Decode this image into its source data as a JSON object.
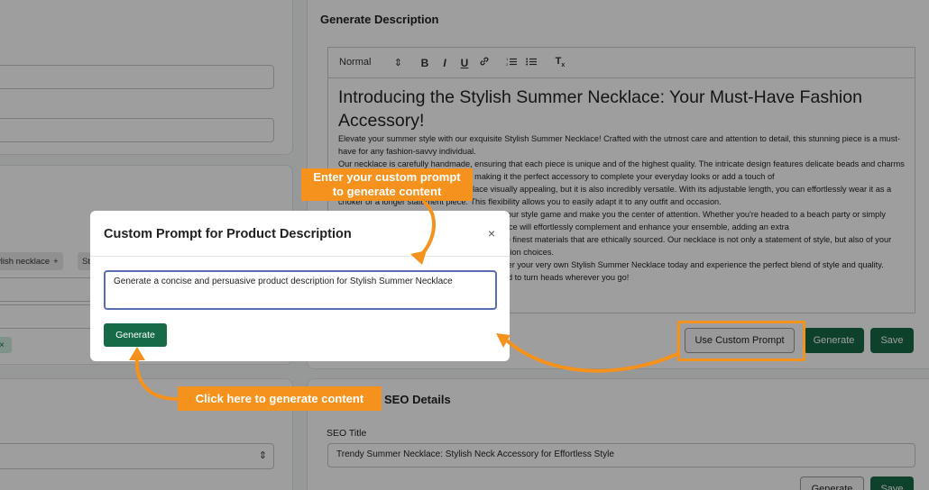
{
  "left_panel": {
    "tags": [
      {
        "label": "ylish necklace",
        "remove": "+"
      },
      {
        "label": "St",
        "remove": ""
      }
    ],
    "chip_green_label": "×"
  },
  "description_section": {
    "title": "Generate Description",
    "toolbar": {
      "format_select": "Normal",
      "select_arrow": "⇕",
      "bold": "B",
      "italic": "I",
      "underline": "U",
      "link": "🔗",
      "ordered_list": "1≡",
      "bullet_list": "•≡",
      "clear_format": "Tx"
    },
    "heading": "Introducing the Stylish Summer Necklace: Your Must-Have Fashion Accessory!",
    "paragraphs": [
      "Elevate your summer style with our exquisite Stylish Summer Necklace! Crafted with the utmost care and attention to detail, this stunning piece is a must-have for any fashion-savvy individual.",
      "Our necklace is carefully handmade, ensuring that each piece is unique and of the highest quality. The intricate design features delicate beads and charms that capture the essence of summer, making it the perfect accessory to complete your everyday looks or add a touch of",
      "Not only is our Stylish Summer Necklace visually appealing, but it is also incredibly versatile. With its adjustable length, you can effortlessly wear it as a choker or a longer statement piece. This flexibility allows you to easily adapt it to any outfit and occasion.",
      "With this necklace, you can instantly elevate your style game and make you the center of attention. Whether you're headed to a beach party or simply running errands during the day out, this necklace will effortlessly complement and enhance your ensemble, adding an extra",
      "We take pride in our materials: we use only the finest materials that are ethically sourced. Our necklace is not only a statement of style, but also of your commitment to environmentally conscious fashion choices.",
      "Don't miss out on this summer accessory! Order your very own Stylish Summer Necklace today and experience the perfect blend of style and quality. Elevate your jewelry collection and be prepared to turn heads wherever you go!"
    ],
    "buttons": {
      "custom_prompt": "Use Custom Prompt",
      "generate": "Generate",
      "save": "Save"
    }
  },
  "seo_section": {
    "title": "SEO Details",
    "seo_title_label": "SEO Title",
    "seo_title_value": "Trendy Summer Necklace: Stylish Neck Accessory for Effortless Style",
    "buttons": {
      "generate": "Generate",
      "save": "Save"
    }
  },
  "modal": {
    "title": "Custom Prompt for Product Description",
    "close": "×",
    "prompt_value": "Generate a concise and persuasive product description for Stylish Summer Necklace",
    "generate_button": "Generate"
  },
  "callouts": {
    "top_line1": "Enter your custom prompt",
    "top_line2": "to generate content",
    "bottom": "Click here to generate content"
  },
  "colors": {
    "accent_orange": "#f5921e",
    "primary_green": "#176a48",
    "input_focus": "#5a6cae"
  }
}
